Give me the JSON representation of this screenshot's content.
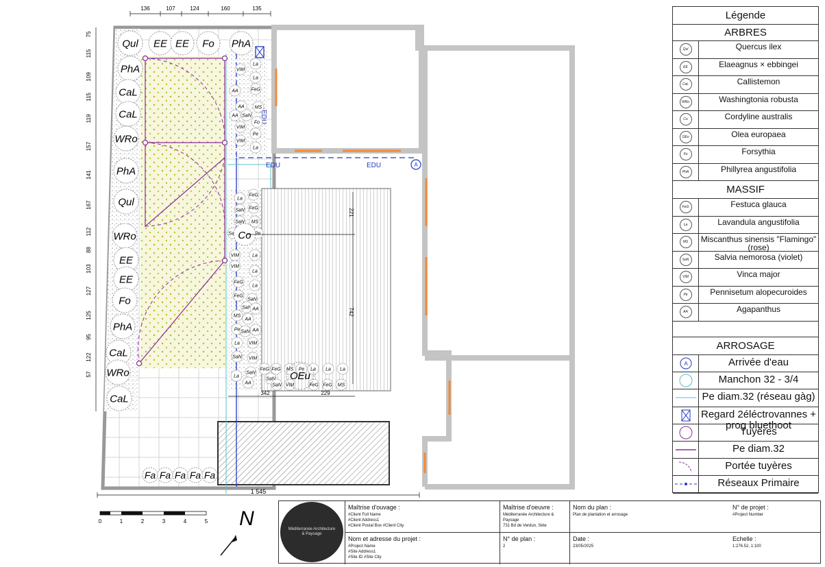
{
  "legend": {
    "title": "Légende",
    "trees_heading": "ARBRES",
    "trees": [
      {
        "code": "Qul",
        "name": "Quercus ilex"
      },
      {
        "code": "EE",
        "name": "Elaeagnus × ebbingei"
      },
      {
        "code": "CaL",
        "name": "Callistemon"
      },
      {
        "code": "WRo",
        "name": "Washingtonia robusta"
      },
      {
        "code": "Co",
        "name": "Cordyline australis"
      },
      {
        "code": "OEu",
        "name": "Olea europaea"
      },
      {
        "code": "Fo",
        "name": "Forsythia"
      },
      {
        "code": "PhA",
        "name": "Phillyrea angustifolia"
      }
    ],
    "massif_heading": "MASSIF",
    "massif": [
      {
        "code": "FeG",
        "name": "Festuca glauca"
      },
      {
        "code": "La",
        "name": "Lavandula angustifolia"
      },
      {
        "code": "MS",
        "name": "Miscanthus sinensis \"Flamingo\" (rose)"
      },
      {
        "code": "SaN",
        "name": "Salvia nemorosa (violet)"
      },
      {
        "code": "VIM",
        "name": "Vinca major"
      },
      {
        "code": "Pe",
        "name": "Pennisetum alopecuroides"
      },
      {
        "code": "AA",
        "name": "Agapanthus"
      }
    ],
    "arrosage_heading": "ARROSAGE",
    "arrosage": [
      {
        "icon": "circle-a",
        "name": "Arrivée d'eau"
      },
      {
        "icon": "circle",
        "name": "Manchon 32 - 3/4"
      },
      {
        "icon": "line-teal",
        "name": "Pe diam.32 (réseau gàg)"
      },
      {
        "icon": "box-x",
        "name": "Regard 2éléctrovannes + prog bluethoot"
      },
      {
        "icon": "circle-purple",
        "name": "Tuyères"
      },
      {
        "icon": "line-purple",
        "name": "Pe diam.32"
      },
      {
        "icon": "arc-dash",
        "name": "Portée tuyères"
      },
      {
        "icon": "line-blue-dash",
        "name": "Réseaux Primaire"
      }
    ]
  },
  "titleblock": {
    "mo_title": "Maîtrise d'ouvage :",
    "mo_value": "#Client Full Name\n#Client Address1\n#Client Postal Box #Client City",
    "moe_title": "Maîtrise d'oeuvre :",
    "moe_value": "Méditerranée Architecture & Paysage\n731 Bd de Verdun, Sète",
    "plan_title": "Nom du plan :",
    "plan_value": "Plan de plantation et arrosage",
    "proj_title": "N° de projet :",
    "proj_value": "#Project Number",
    "addr_title": "Nom et adresse du projet :",
    "addr_value": "#Project Name\n#Site Address1\n#Site ID #Site City",
    "planno_title": "N° de plan :",
    "planno_value": "2",
    "date_title": "Date :",
    "date_value": "23/05/2025",
    "scale_title": "Echelle :",
    "scale_value": "1:276.52, 1:100",
    "logo_name": "Méditerranée Architecture",
    "logo_sub": "& Paysage"
  },
  "dims": {
    "top": [
      "136",
      "107",
      "124",
      "160",
      "135"
    ],
    "left": [
      "75",
      "115",
      "109",
      "115",
      "119",
      "157",
      "141",
      "167",
      "112",
      "88",
      "103",
      "127",
      "125",
      "95",
      "122",
      "57"
    ],
    "bottom": "1 545",
    "deck_w1": "342",
    "deck_w2": "229",
    "deck_h": "742",
    "deck_top": "221"
  },
  "scalebar": [
    "0",
    "1",
    "2",
    "3",
    "4",
    "5"
  ],
  "north": "N",
  "pipe_labels": {
    "vertical": "EDU",
    "h1": "EDU",
    "h2": "EDU"
  },
  "water_inlet": "A",
  "plants_left": [
    "Qul",
    "PhA",
    "CaL",
    "CaL",
    "WRo",
    "PhA",
    "Qul",
    "WRo",
    "EE",
    "EE",
    "Fo",
    "PhA",
    "CaL",
    "WRo",
    "CaL"
  ],
  "plants_top": [
    "EE",
    "EE",
    "Fo",
    "PhA"
  ],
  "plants_bottom": [
    "Fa",
    "Fa",
    "Fa",
    "Fa",
    "Fa"
  ],
  "center_trees": [
    "Co",
    "OEu"
  ]
}
